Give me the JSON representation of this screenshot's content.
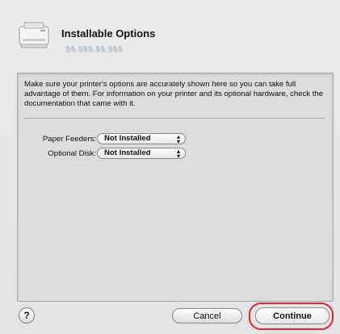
{
  "dialog": {
    "title": "Installable Options",
    "printer_address": "55.555.55.555",
    "description": "Make sure your printer's options are accurately shown here so you can take full advantage of them.  For information on your printer and its optional hardware, check the documentation that came with it."
  },
  "options": [
    {
      "label": "Paper Feeders:",
      "value": "Not Installed"
    },
    {
      "label": "Optional Disk:",
      "value": "Not Installed"
    }
  ],
  "buttons": {
    "help": "?",
    "cancel": "Cancel",
    "continue": "Continue"
  },
  "colors": {
    "highlight": "#e0283c"
  },
  "icons": {
    "printer": "printer-icon",
    "popup_arrows": "up-down-chevrons-icon"
  }
}
